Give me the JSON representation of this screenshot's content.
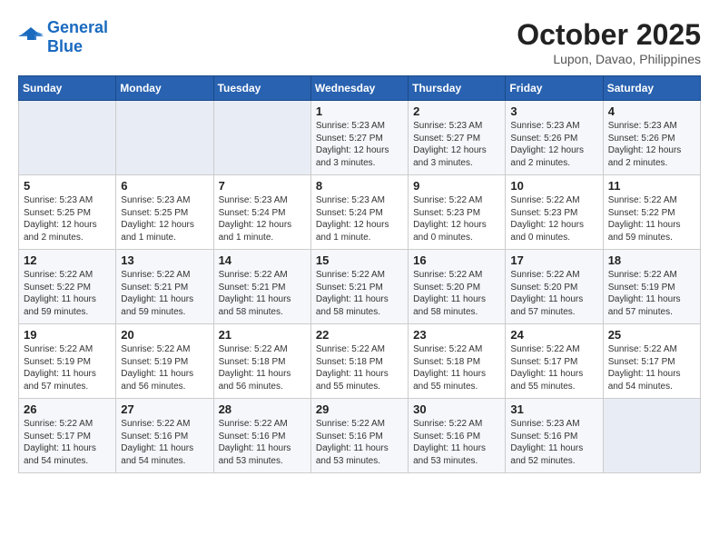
{
  "header": {
    "logo_line1": "General",
    "logo_line2": "Blue",
    "month_year": "October 2025",
    "location": "Lupon, Davao, Philippines"
  },
  "days_of_week": [
    "Sunday",
    "Monday",
    "Tuesday",
    "Wednesday",
    "Thursday",
    "Friday",
    "Saturday"
  ],
  "weeks": [
    [
      {
        "day": "",
        "info": ""
      },
      {
        "day": "",
        "info": ""
      },
      {
        "day": "",
        "info": ""
      },
      {
        "day": "1",
        "info": "Sunrise: 5:23 AM\nSunset: 5:27 PM\nDaylight: 12 hours\nand 3 minutes."
      },
      {
        "day": "2",
        "info": "Sunrise: 5:23 AM\nSunset: 5:27 PM\nDaylight: 12 hours\nand 3 minutes."
      },
      {
        "day": "3",
        "info": "Sunrise: 5:23 AM\nSunset: 5:26 PM\nDaylight: 12 hours\nand 2 minutes."
      },
      {
        "day": "4",
        "info": "Sunrise: 5:23 AM\nSunset: 5:26 PM\nDaylight: 12 hours\nand 2 minutes."
      }
    ],
    [
      {
        "day": "5",
        "info": "Sunrise: 5:23 AM\nSunset: 5:25 PM\nDaylight: 12 hours\nand 2 minutes."
      },
      {
        "day": "6",
        "info": "Sunrise: 5:23 AM\nSunset: 5:25 PM\nDaylight: 12 hours\nand 1 minute."
      },
      {
        "day": "7",
        "info": "Sunrise: 5:23 AM\nSunset: 5:24 PM\nDaylight: 12 hours\nand 1 minute."
      },
      {
        "day": "8",
        "info": "Sunrise: 5:23 AM\nSunset: 5:24 PM\nDaylight: 12 hours\nand 1 minute."
      },
      {
        "day": "9",
        "info": "Sunrise: 5:22 AM\nSunset: 5:23 PM\nDaylight: 12 hours\nand 0 minutes."
      },
      {
        "day": "10",
        "info": "Sunrise: 5:22 AM\nSunset: 5:23 PM\nDaylight: 12 hours\nand 0 minutes."
      },
      {
        "day": "11",
        "info": "Sunrise: 5:22 AM\nSunset: 5:22 PM\nDaylight: 11 hours\nand 59 minutes."
      }
    ],
    [
      {
        "day": "12",
        "info": "Sunrise: 5:22 AM\nSunset: 5:22 PM\nDaylight: 11 hours\nand 59 minutes."
      },
      {
        "day": "13",
        "info": "Sunrise: 5:22 AM\nSunset: 5:21 PM\nDaylight: 11 hours\nand 59 minutes."
      },
      {
        "day": "14",
        "info": "Sunrise: 5:22 AM\nSunset: 5:21 PM\nDaylight: 11 hours\nand 58 minutes."
      },
      {
        "day": "15",
        "info": "Sunrise: 5:22 AM\nSunset: 5:21 PM\nDaylight: 11 hours\nand 58 minutes."
      },
      {
        "day": "16",
        "info": "Sunrise: 5:22 AM\nSunset: 5:20 PM\nDaylight: 11 hours\nand 58 minutes."
      },
      {
        "day": "17",
        "info": "Sunrise: 5:22 AM\nSunset: 5:20 PM\nDaylight: 11 hours\nand 57 minutes."
      },
      {
        "day": "18",
        "info": "Sunrise: 5:22 AM\nSunset: 5:19 PM\nDaylight: 11 hours\nand 57 minutes."
      }
    ],
    [
      {
        "day": "19",
        "info": "Sunrise: 5:22 AM\nSunset: 5:19 PM\nDaylight: 11 hours\nand 57 minutes."
      },
      {
        "day": "20",
        "info": "Sunrise: 5:22 AM\nSunset: 5:19 PM\nDaylight: 11 hours\nand 56 minutes."
      },
      {
        "day": "21",
        "info": "Sunrise: 5:22 AM\nSunset: 5:18 PM\nDaylight: 11 hours\nand 56 minutes."
      },
      {
        "day": "22",
        "info": "Sunrise: 5:22 AM\nSunset: 5:18 PM\nDaylight: 11 hours\nand 55 minutes."
      },
      {
        "day": "23",
        "info": "Sunrise: 5:22 AM\nSunset: 5:18 PM\nDaylight: 11 hours\nand 55 minutes."
      },
      {
        "day": "24",
        "info": "Sunrise: 5:22 AM\nSunset: 5:17 PM\nDaylight: 11 hours\nand 55 minutes."
      },
      {
        "day": "25",
        "info": "Sunrise: 5:22 AM\nSunset: 5:17 PM\nDaylight: 11 hours\nand 54 minutes."
      }
    ],
    [
      {
        "day": "26",
        "info": "Sunrise: 5:22 AM\nSunset: 5:17 PM\nDaylight: 11 hours\nand 54 minutes."
      },
      {
        "day": "27",
        "info": "Sunrise: 5:22 AM\nSunset: 5:16 PM\nDaylight: 11 hours\nand 54 minutes."
      },
      {
        "day": "28",
        "info": "Sunrise: 5:22 AM\nSunset: 5:16 PM\nDaylight: 11 hours\nand 53 minutes."
      },
      {
        "day": "29",
        "info": "Sunrise: 5:22 AM\nSunset: 5:16 PM\nDaylight: 11 hours\nand 53 minutes."
      },
      {
        "day": "30",
        "info": "Sunrise: 5:22 AM\nSunset: 5:16 PM\nDaylight: 11 hours\nand 53 minutes."
      },
      {
        "day": "31",
        "info": "Sunrise: 5:23 AM\nSunset: 5:16 PM\nDaylight: 11 hours\nand 52 minutes."
      },
      {
        "day": "",
        "info": ""
      }
    ]
  ]
}
